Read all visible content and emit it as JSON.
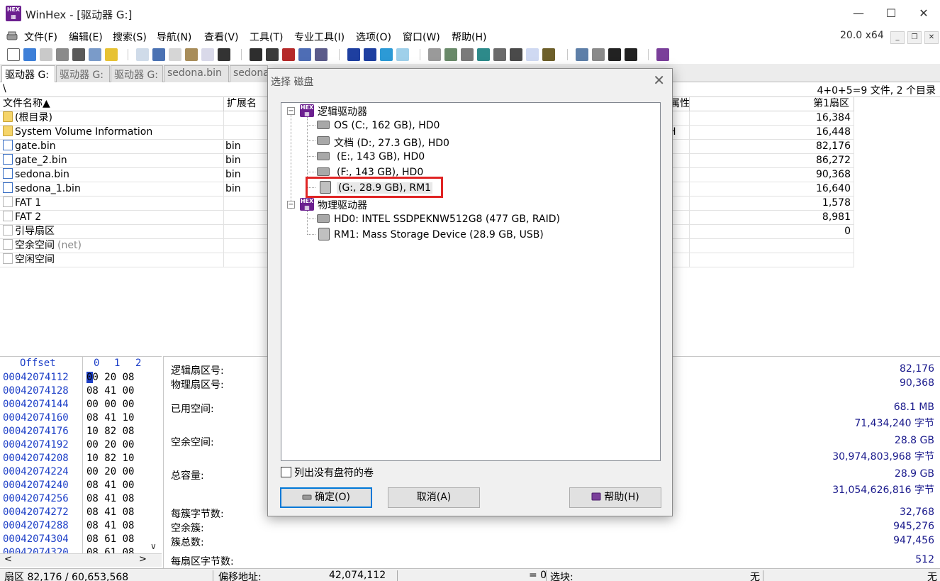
{
  "window": {
    "title": "WinHex - [驱动器 G:]",
    "minimize": "—",
    "maximize": "☐",
    "close": "✕"
  },
  "menu": {
    "items": [
      "文件(F)",
      "编辑(E)",
      "搜索(S)",
      "导航(N)",
      "查看(V)",
      "工具(T)",
      "专业工具(I)",
      "选项(O)",
      "窗口(W)",
      "帮助(H)"
    ],
    "version": "20.0 x64"
  },
  "tabs": [
    "驱动器 G:",
    "驱动器 G:",
    "驱动器 G:",
    "sedona.bin",
    "sedona"
  ],
  "path": {
    "current": "\\",
    "summary": "4+0+5=9 文件, 2 个目录"
  },
  "filelist": {
    "headers": {
      "name": "文件名称▲",
      "ext": "扩展名",
      "attr": "属性",
      "first_sector": "第1扇区"
    },
    "rows": [
      {
        "name": "(根目录)",
        "ext": "",
        "attr": "",
        "sector": "16,384",
        "icon": "folder"
      },
      {
        "name": "System Volume Information",
        "ext": "",
        "attr": "H",
        "sector": "16,448",
        "icon": "folder"
      },
      {
        "name": "gate.bin",
        "ext": "bin",
        "attr": "",
        "sector": "82,176",
        "icon": "file"
      },
      {
        "name": "gate_2.bin",
        "ext": "bin",
        "attr": "",
        "sector": "86,272",
        "icon": "file"
      },
      {
        "name": "sedona.bin",
        "ext": "bin",
        "attr": "",
        "sector": "90,368",
        "icon": "file"
      },
      {
        "name": "sedona_1.bin",
        "ext": "bin",
        "attr": "",
        "sector": "16,640",
        "icon": "file"
      },
      {
        "name": "FAT 1",
        "ext": "",
        "attr": "",
        "sector": "1,578",
        "icon": "blank"
      },
      {
        "name": "FAT 2",
        "ext": "",
        "attr": "",
        "sector": "8,981",
        "icon": "blank"
      },
      {
        "name": "引导扇区",
        "ext": "",
        "attr": "",
        "sector": "0",
        "icon": "blank"
      },
      {
        "name": "空余空间",
        "name_suffix": "(net)",
        "ext": "",
        "attr": "",
        "sector": "",
        "icon": "blank"
      },
      {
        "name": "空闲空间",
        "ext": "",
        "attr": "",
        "sector": "",
        "icon": "blank"
      }
    ]
  },
  "hex": {
    "header_offset": "Offset",
    "header_cols": [
      "0",
      "1",
      "2"
    ],
    "rows": [
      {
        "offset": "00042074112",
        "bytes": "00 20 08"
      },
      {
        "offset": "00042074128",
        "bytes": "08 41 00"
      },
      {
        "offset": "00042074144",
        "bytes": "00 00 00"
      },
      {
        "offset": "00042074160",
        "bytes": "08 41 10"
      },
      {
        "offset": "00042074176",
        "bytes": "10 82 08"
      },
      {
        "offset": "00042074192",
        "bytes": "00 20 00"
      },
      {
        "offset": "00042074208",
        "bytes": "10 82 10"
      },
      {
        "offset": "00042074224",
        "bytes": "00 20 00"
      },
      {
        "offset": "00042074240",
        "bytes": "08 41 00"
      },
      {
        "offset": "00042074256",
        "bytes": "08 41 08"
      },
      {
        "offset": "00042074272",
        "bytes": "08 41 08"
      },
      {
        "offset": "00042074288",
        "bytes": "08 41 08"
      },
      {
        "offset": "00042074304",
        "bytes": "08 61 08"
      },
      {
        "offset": "00042074320",
        "bytes": "08 61 08"
      }
    ]
  },
  "info": {
    "logical_sector_label": "逻辑扇区号:",
    "logical_sector": "82,176",
    "physical_sector_label": "物理扇区号:",
    "physical_sector": "90,368",
    "used_label": "已用空间:",
    "used_mb": "68.1 MB",
    "used_bytes": "71,434,240 字节",
    "free_label": "空余空间:",
    "free_gb": "28.8 GB",
    "free_bytes": "30,974,803,968 字节",
    "total_label": "总容量:",
    "total_gb": "28.9 GB",
    "total_bytes": "31,054,626,816 字节",
    "bytes_per_cluster_label": "每簇字节数:",
    "bytes_per_cluster": "32,768",
    "free_clusters_label": "空余簇:",
    "free_clusters": "945,276",
    "total_clusters_label": "簇总数:",
    "total_clusters": "947,456",
    "bytes_per_sector_label": "每扇区字节数:",
    "bytes_per_sector": "512"
  },
  "status": {
    "sector": "扇区 82,176 / 60,653,568",
    "offset_label": "偏移地址:",
    "offset": "42,074,112",
    "value": "= 0",
    "selection_label": "选块:",
    "none1": "无",
    "none2": "无"
  },
  "dialog": {
    "title": "选择 磁盘",
    "close": "✕",
    "logical_group": "逻辑驱动器",
    "logical_drives": [
      "OS (C:, 162 GB), HD0",
      "文档 (D:, 27.3 GB), HD0",
      "(E:, 143 GB), HD0",
      "(F:, 143 GB), HD0",
      "(G:, 28.9 GB), RM1"
    ],
    "physical_group": "物理驱动器",
    "physical_drives": [
      "HD0: INTEL SSDPEKNW512G8 (477 GB, RAID)",
      "RM1: Mass Storage Device (28.9 GB, USB)"
    ],
    "collapse_glyph": "−",
    "checkbox_label": "列出没有盘符的卷",
    "ok": "确定(O)",
    "cancel": "取消(A)",
    "help": "帮助(H)"
  },
  "colors": {
    "hex_brand": "#6b1f8f",
    "offset_blue": "#1e40c8",
    "value_blue": "#1a1a8c",
    "highlight_red": "#e02424",
    "default_button": "#0078d7"
  },
  "icons": [
    "hex-logo-icon",
    "folder-icon",
    "file-icon",
    "drive-icon",
    "removable-drive-icon",
    "help-book-icon"
  ]
}
